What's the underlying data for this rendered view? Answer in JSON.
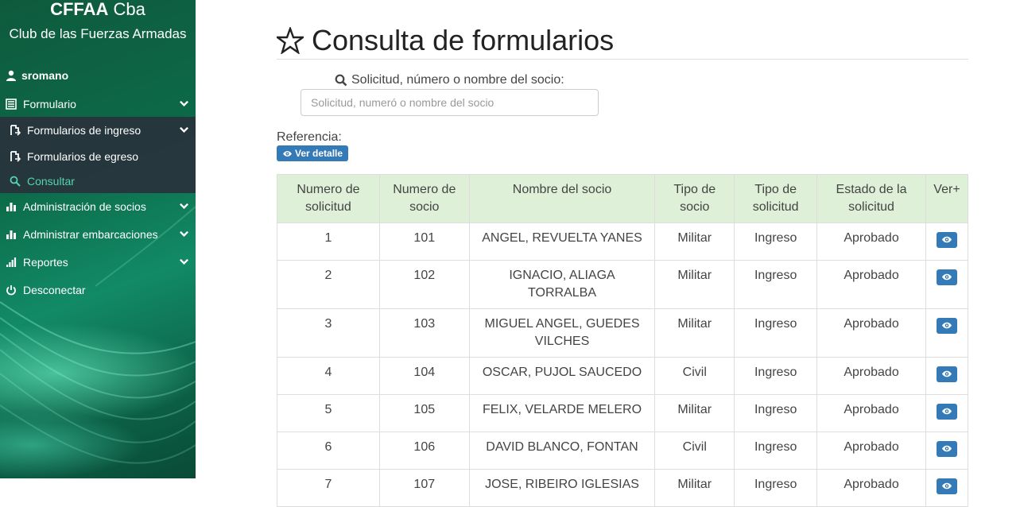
{
  "brand": {
    "title_bold": "CFFAA",
    "title_rest": "Cba",
    "subtitle": "Club de las Fuerzas Armadas"
  },
  "sidebar": {
    "user": "sromano",
    "items": [
      {
        "label": "Formulario",
        "icon": "list-icon"
      },
      {
        "label": "Formularios de ingreso",
        "icon": "form-in-icon"
      },
      {
        "label": "Formularios de egreso",
        "icon": "form-out-icon"
      },
      {
        "label": "Consultar",
        "icon": "search-icon"
      },
      {
        "label": "Administración de socios",
        "icon": "bar-chart-icon"
      },
      {
        "label": "Administrar embarcaciones",
        "icon": "bar-chart-icon"
      },
      {
        "label": "Reportes",
        "icon": "signal-icon"
      },
      {
        "label": "Desconectar",
        "icon": "power-icon"
      }
    ]
  },
  "page": {
    "title": "Consulta de formularios",
    "search_label": "Solicitud, número o nombre del socio:",
    "search_placeholder": "Solicitud, numeró o nombre del socio",
    "reference_label": "Referencia:",
    "ver_detalle": "Ver detalle"
  },
  "table": {
    "headers": [
      "Numero de solicitud",
      "Numero de socio",
      "Nombre del socio",
      "Tipo de socio",
      "Tipo de solicitud",
      "Estado de la solicitud",
      "Ver+"
    ],
    "rows": [
      [
        "1",
        "101",
        "ANGEL, REVUELTA YANES",
        "Militar",
        "Ingreso",
        "Aprobado"
      ],
      [
        "2",
        "102",
        "IGNACIO, ALIAGA TORRALBA",
        "Militar",
        "Ingreso",
        "Aprobado"
      ],
      [
        "3",
        "103",
        "MIGUEL ANGEL, GUEDES VILCHES",
        "Militar",
        "Ingreso",
        "Aprobado"
      ],
      [
        "4",
        "104",
        "OSCAR, PUJOL SAUCEDO",
        "Civil",
        "Ingreso",
        "Aprobado"
      ],
      [
        "5",
        "105",
        "FELIX, VELARDE MELERO",
        "Militar",
        "Ingreso",
        "Aprobado"
      ],
      [
        "6",
        "106",
        "DAVID BLANCO, FONTAN",
        "Civil",
        "Ingreso",
        "Aprobado"
      ],
      [
        "7",
        "107",
        "JOSE, RIBEIRO IGLESIAS",
        "Militar",
        "Ingreso",
        "Aprobado"
      ]
    ]
  },
  "colors": {
    "sidebar_green": "#0c6a48",
    "accent_blue": "#337ab7",
    "header_green": "#dff0d8",
    "active_teal": "#52d6b0"
  }
}
